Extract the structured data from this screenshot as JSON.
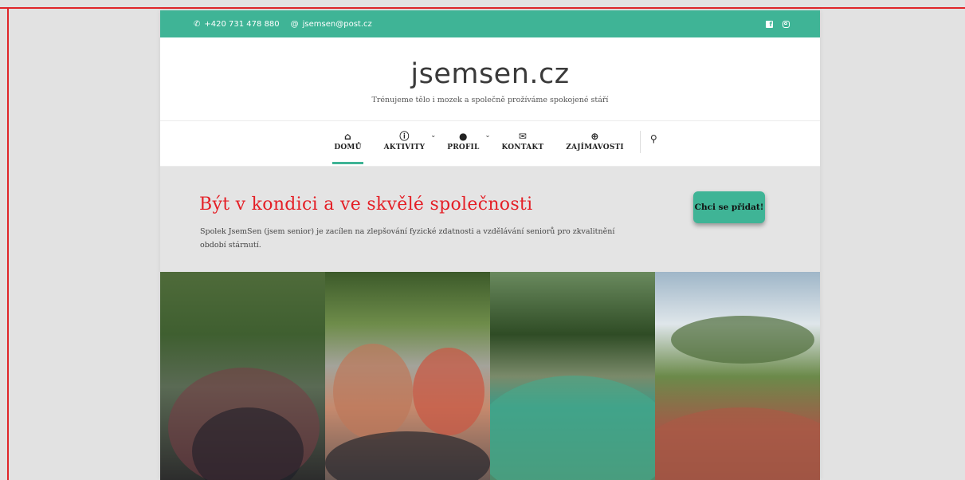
{
  "topbar": {
    "phone": "+420 731 478 880",
    "email": "jsemsen@post.cz",
    "phone_icon": "phone-icon",
    "email_icon": "at-icon",
    "social_icons": [
      "facebook-icon",
      "instagram-icon"
    ]
  },
  "header": {
    "site_title": "jsemsen.cz",
    "tagline": "Trénujeme tělo i mozek a společně prožíváme spokojené stáří"
  },
  "nav": {
    "items": [
      {
        "icon": "home-icon",
        "glyph": "⌂",
        "label": "DOMŮ",
        "active": true,
        "dropdown": false
      },
      {
        "icon": "info-icon",
        "glyph": "ⓘ",
        "label": "AKTIVITY",
        "active": false,
        "dropdown": true
      },
      {
        "icon": "user-icon",
        "glyph": "●",
        "label": "PROFIL",
        "active": false,
        "dropdown": true
      },
      {
        "icon": "envelope-icon",
        "glyph": "✉",
        "label": "KONTAKT",
        "active": false,
        "dropdown": false
      },
      {
        "icon": "plus-circle-icon",
        "glyph": "⊕",
        "label": "ZAJÍMAVOSTI",
        "active": false,
        "dropdown": false
      }
    ],
    "caret": "⌄",
    "search_icon": "search-icon",
    "search_glyph": "⚲"
  },
  "hero": {
    "heading": "Být v kondici a ve skvělé společnosti",
    "text": "Spolek JsemSen (jsem senior) je zacílen na zlepšování fyzické zdatnosti a vzdělávání seniorů pro zkvalitnění období stárnutí.",
    "cta_label": "Chci se přidat!"
  },
  "colors": {
    "accent": "#3fb496",
    "heading_red": "#e41f26",
    "frame_red": "#e0262a"
  }
}
